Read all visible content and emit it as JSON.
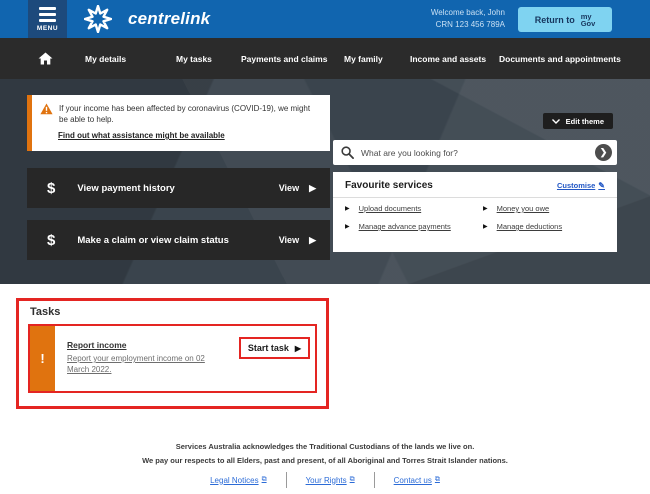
{
  "header": {
    "menu_label": "MENU",
    "brand": "centrelink",
    "welcome_line1": "Welcome back, John",
    "welcome_line2": "CRN 123 456 789A",
    "return_button_label": "Return to",
    "mygov_top": "my",
    "mygov_bottom": "Gov"
  },
  "nav": {
    "items": [
      {
        "label": "My details"
      },
      {
        "label": "My tasks"
      },
      {
        "label": "Payments and claims"
      },
      {
        "label": "My family"
      },
      {
        "label": "Income and assets"
      },
      {
        "label": "Documents and appointments"
      }
    ]
  },
  "hero": {
    "alert": {
      "text": "If your income has been affected by coronavirus (COVID-19), we might be able to help.",
      "link": "Find out what assistance might be available"
    },
    "edit_theme_label": "Edit theme",
    "search": {
      "placeholder": "What are you looking for?"
    },
    "cards": [
      {
        "icon": "dollar-icon",
        "title": "View payment history",
        "action": "View"
      },
      {
        "icon": "dollar-icon",
        "title": "Make a claim or view claim status",
        "action": "View"
      }
    ],
    "favourites": {
      "title": "Favourite services",
      "customise": "Customise",
      "links": [
        {
          "label": "Upload documents"
        },
        {
          "label": "Money you owe"
        },
        {
          "label": "Manage advance payments"
        },
        {
          "label": "Manage deductions"
        }
      ]
    }
  },
  "tasks": {
    "heading": "Tasks",
    "task": {
      "title": "Report income",
      "description": "Report your employment income on 02 March 2022.",
      "button": "Start task"
    }
  },
  "footer": {
    "acknowledgement_line1": "Services Australia acknowledges the Traditional Custodians of the lands we live on.",
    "acknowledgement_line2": "We pay our respects to all Elders, past and present, of all Aboriginal and Torres Strait Islander nations.",
    "links": [
      {
        "label": "Legal Notices"
      },
      {
        "label": "Your Rights"
      },
      {
        "label": "Contact us"
      }
    ]
  },
  "colors": {
    "header_blue": "#1165af",
    "menu_navy": "#1d4a7c",
    "nav_dark": "#2b2b2b",
    "hero_slate": "#3a444d",
    "orange_accent": "#e0730f",
    "annotation_red": "#e42522",
    "mygov_lightblue": "#7fd3f1",
    "link_blue": "#2b6bd7"
  }
}
